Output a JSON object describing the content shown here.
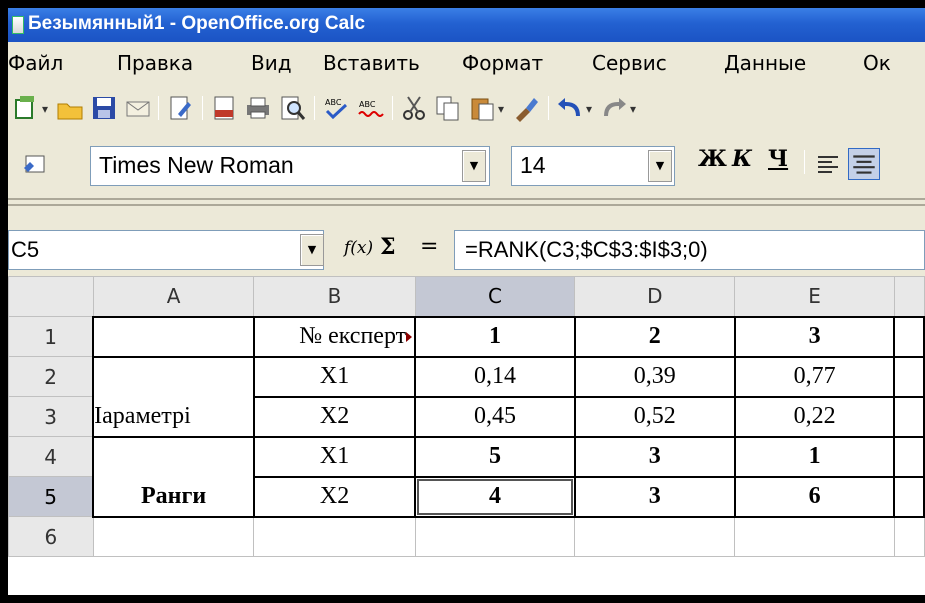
{
  "window": {
    "title": "Безымянный1 - OpenOffice.org Calc"
  },
  "menu": {
    "items": [
      "Файл",
      "Правка",
      "Вид",
      "Вставить",
      "Формат",
      "Сервис",
      "Данные",
      "Ок"
    ]
  },
  "format_toolbar": {
    "font_name": "Times New Roman",
    "font_size": "14",
    "bold_label": "Ж",
    "italic_label": "К",
    "underline_label": "Ч"
  },
  "formula_bar": {
    "name_box": "C5",
    "fx_label": "f(x)",
    "sum_label": "Σ",
    "equals_label": "=",
    "formula": "=RANK(C3;$C$3:$I$3;0)"
  },
  "grid": {
    "columns": [
      "A",
      "B",
      "C",
      "D",
      "E"
    ],
    "rows": [
      "1",
      "2",
      "3",
      "4",
      "5",
      "6"
    ],
    "cells": {
      "B1": "№ експерт",
      "C1": "1",
      "D1": "2",
      "E1": "3",
      "B2": "X1",
      "C2": "0,14",
      "D2": "0,39",
      "E2": "0,77",
      "A3": "Іараметрі",
      "B3": "X2",
      "C3": "0,45",
      "D3": "0,52",
      "E3": "0,22",
      "B4": "X1",
      "C4": "5",
      "D4": "3",
      "E4": "1",
      "A5": "Ранги",
      "B5": "X2",
      "C5": "4",
      "D5": "3",
      "E5": "6"
    }
  }
}
